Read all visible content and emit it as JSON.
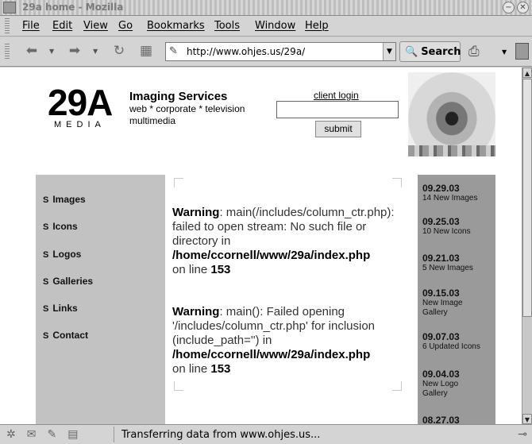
{
  "window": {
    "title": "29a home - Mozilla"
  },
  "menubar": {
    "items": [
      "File",
      "Edit",
      "View",
      "Go",
      "Bookmarks",
      "Tools",
      "Window",
      "Help"
    ]
  },
  "toolbar": {
    "back_icon": "back-arrow-icon",
    "forward_icon": "forward-arrow-icon",
    "reload_icon": "reload-icon",
    "stop_icon": "stop-icon",
    "url": "http://www.ohjes.us/29a/",
    "search_label": "Search",
    "print_icon": "printer-icon"
  },
  "page": {
    "logo_big": "29A",
    "logo_small": "MEDIA",
    "services_heading": "Imaging Services",
    "services_line1": "web * corporate * television",
    "services_line2": "multimedia",
    "login_label": "client login",
    "login_input_value": "",
    "submit_label": "submit",
    "nav": [
      {
        "bullet": "S",
        "label": "Images"
      },
      {
        "bullet": "S",
        "label": "Icons"
      },
      {
        "bullet": "S",
        "label": "Logos"
      },
      {
        "bullet": "S",
        "label": "Galleries"
      },
      {
        "bullet": "S",
        "label": "Links"
      },
      {
        "bullet": "S",
        "label": "Contact"
      }
    ],
    "warnings": [
      {
        "label": "Warning",
        "text": ": main(/includes/column_ctr.php): failed to open stream: No such file or directory in",
        "path": "/home/ccornell/www/29a/index.php",
        "on_line": "on line",
        "line": "153"
      },
      {
        "label": "Warning",
        "text": ": main(): Failed opening '/includes/column_ctr.php' for inclusion (include_path='') in",
        "path": "/home/ccornell/www/29a/index.php",
        "on_line": "on line",
        "line": "153"
      }
    ],
    "news": [
      {
        "date": "09.29.03",
        "desc": "14 New Images"
      },
      {
        "date": "09.25.03",
        "desc": "10 New Icons"
      },
      {
        "date": "09.21.03",
        "desc": "5 New Images"
      },
      {
        "date": "09.15.03",
        "desc": "New Image Gallery"
      },
      {
        "date": "09.07.03",
        "desc": "6 Updated Icons"
      },
      {
        "date": "09.04.03",
        "desc": "New Logo Gallery"
      },
      {
        "date": "08.27.03",
        "desc": ""
      }
    ]
  },
  "status": {
    "text": "Transferring data from www.ohjes.us..."
  }
}
